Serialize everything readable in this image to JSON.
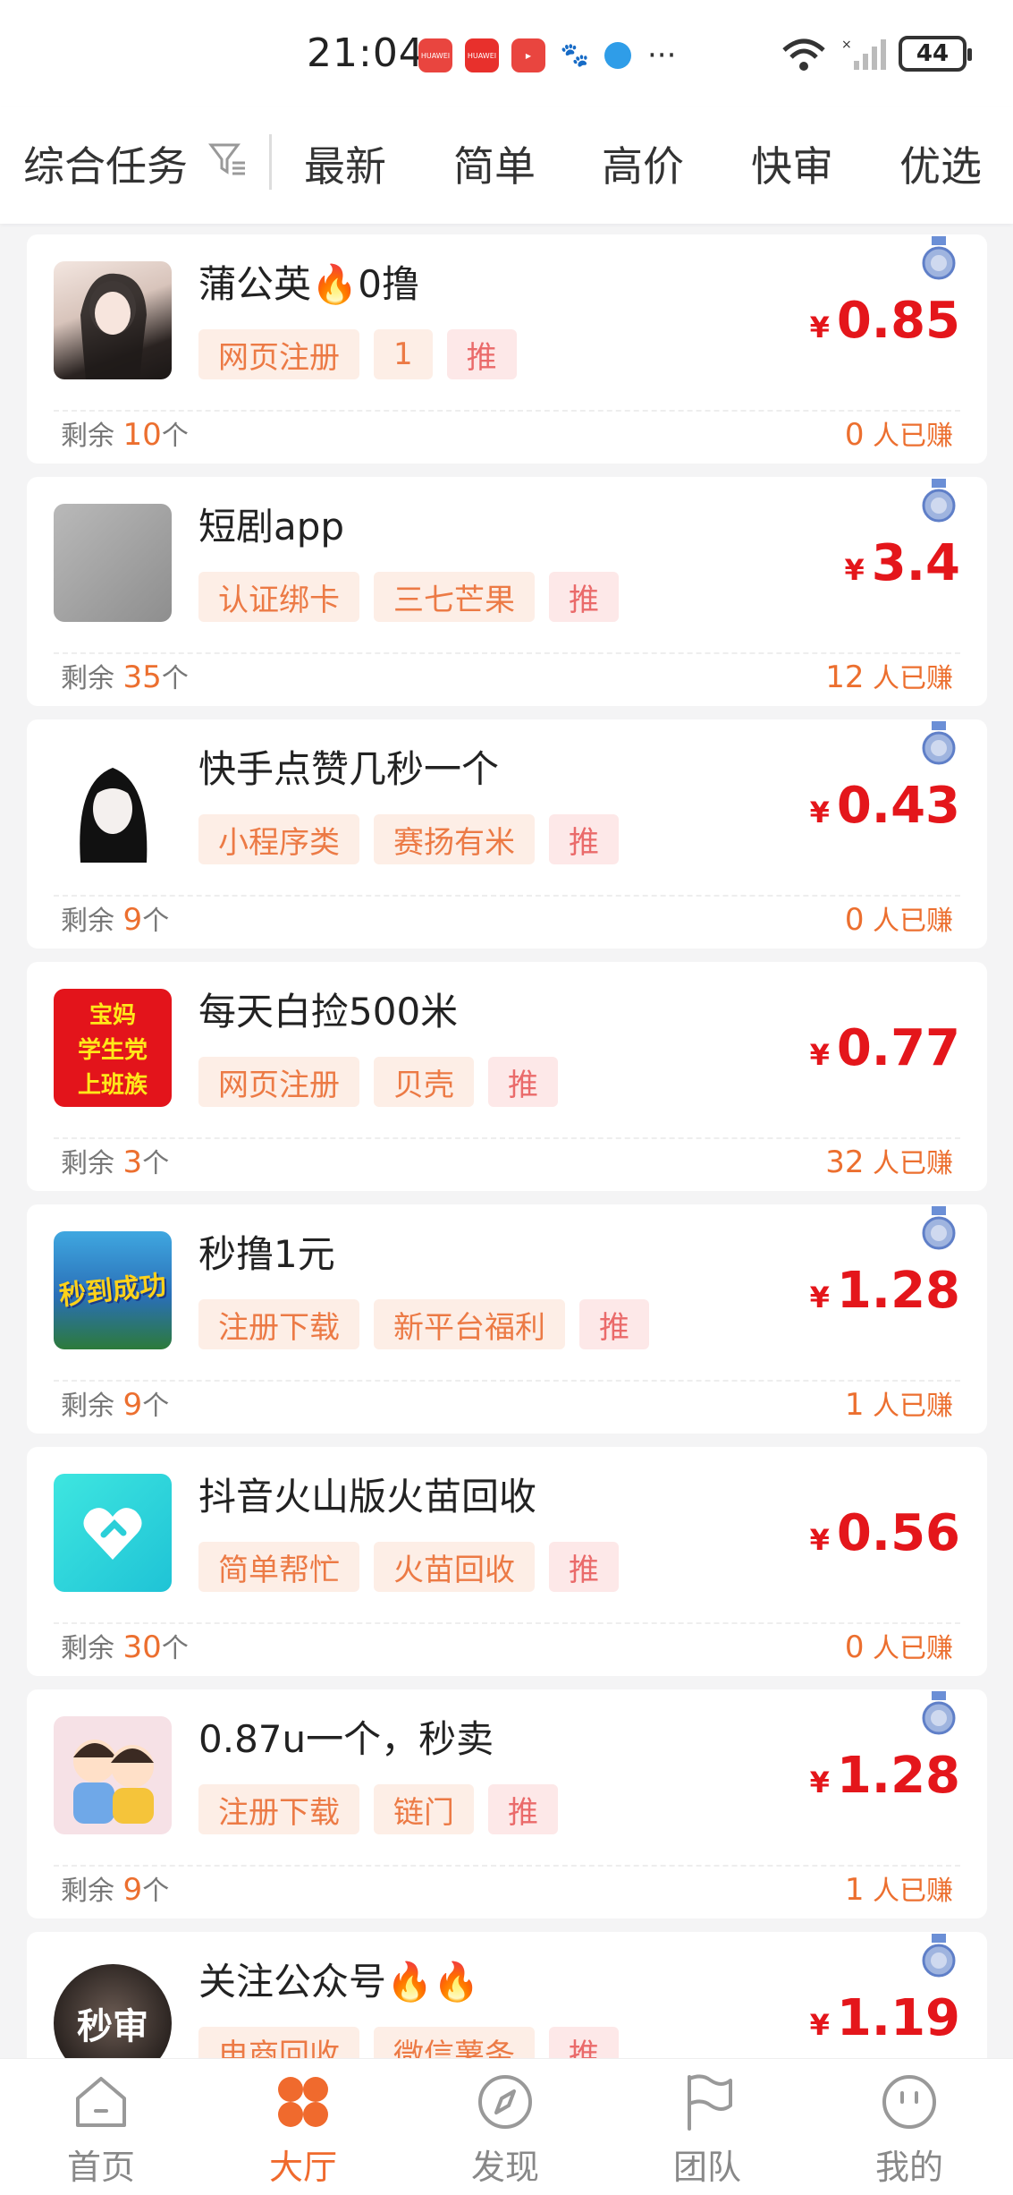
{
  "status_bar": {
    "time": "21:04",
    "battery": "44",
    "network": "6"
  },
  "tabs": {
    "first": "综合任务",
    "items": [
      "最新",
      "简单",
      "高价",
      "快审",
      "优选"
    ]
  },
  "remain_label": "剩余",
  "unit_label": "个",
  "earned_suffix": "人已赚",
  "currency": "¥",
  "tasks": [
    {
      "title": "蒲公英🔥0撸",
      "tags": [
        "网页注册",
        "1",
        "推"
      ],
      "price": "0.85",
      "remain": "10",
      "earned": "0",
      "medal": true
    },
    {
      "title": "短剧app",
      "tags": [
        "认证绑卡",
        "三七芒果",
        "推"
      ],
      "price": "3.4",
      "remain": "35",
      "earned": "12",
      "medal": true
    },
    {
      "title": "快手点赞几秒一个",
      "tags": [
        "小程序类",
        "赛扬有米",
        "推"
      ],
      "price": "0.43",
      "remain": "9",
      "earned": "0",
      "medal": true
    },
    {
      "title": "每天白捡500米",
      "tags": [
        "网页注册",
        "贝壳",
        "推"
      ],
      "price": "0.77",
      "remain": "3",
      "earned": "32",
      "medal": false
    },
    {
      "title": "秒撸1元",
      "tags": [
        "注册下载",
        "新平台福利",
        "推"
      ],
      "price": "1.28",
      "remain": "9",
      "earned": "1",
      "medal": true
    },
    {
      "title": "抖音火山版火苗回收",
      "tags": [
        "简单帮忙",
        "火苗回收",
        "推"
      ],
      "price": "0.56",
      "remain": "30",
      "earned": "0",
      "medal": false
    },
    {
      "title": "0.87u一个，秒卖",
      "tags": [
        "注册下载",
        "链门",
        "推"
      ],
      "price": "1.28",
      "remain": "9",
      "earned": "1",
      "medal": true
    },
    {
      "title": "关注公众号🔥🔥",
      "tags": [
        "电商回收",
        "微信薯条",
        "推"
      ],
      "price": "1.19",
      "remain": "",
      "earned": "",
      "medal": true
    }
  ],
  "thumb_texts": {
    "task4": [
      "宝妈",
      "学生党",
      "上班族"
    ],
    "task5": "秒到成功",
    "task8": "秒审"
  },
  "bottom_nav": [
    {
      "label": "首页",
      "icon": "home-icon",
      "active": false
    },
    {
      "label": "大厅",
      "icon": "hall-grid-icon",
      "active": true
    },
    {
      "label": "发现",
      "icon": "compass-icon",
      "active": false
    },
    {
      "label": "团队",
      "icon": "flag-icon",
      "active": false
    },
    {
      "label": "我的",
      "icon": "smile-face-icon",
      "active": false
    }
  ],
  "colors": {
    "accent": "#f06a2d",
    "price": "#e4161b",
    "tag_bg": "#fdeee6",
    "tag_text": "#ec7a45"
  }
}
